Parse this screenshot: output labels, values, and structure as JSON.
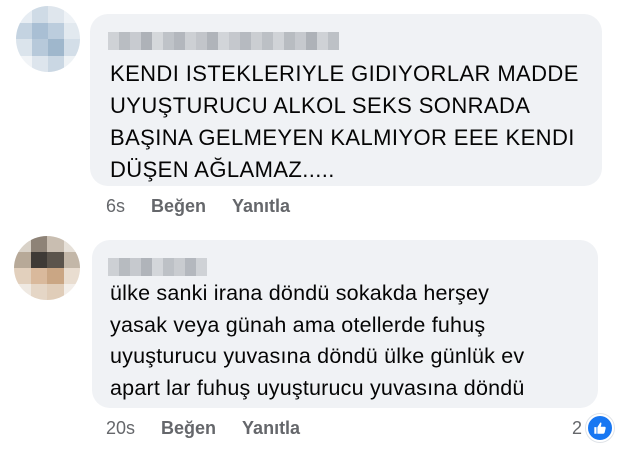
{
  "colors": {
    "bubble_bg": "#f0f2f5",
    "text": "#050505",
    "secondary_text": "#65676b",
    "like_blue": "#1877f2"
  },
  "comments": [
    {
      "author": "",
      "lines": [
        "KENDI ISTEKLERIYLE GIDIYORLAR MADDE",
        "UYUŞTURUCU ALKOL SEKS SONRADA",
        "BAŞINA GELMEYEN KALMIYOR EEE KENDI",
        "DÜŞEN AĞLAMAZ....."
      ],
      "timestamp": "6s",
      "like_label": "Beğen",
      "reply_label": "Yanıtla"
    },
    {
      "author": "",
      "lines": [
        "ülke  sanki irana döndü sokakda herşey",
        "yasak veya günah ama otellerde fuhuş",
        "uyuşturucu yuvasına döndü ülke günlük ev",
        "apart lar fuhuş uyuşturucu yuvasına döndü"
      ],
      "timestamp": "20s",
      "like_label": "Beğen",
      "reply_label": "Yanıtla",
      "reaction_count": "2",
      "reaction_icon": "like-icon"
    }
  ]
}
